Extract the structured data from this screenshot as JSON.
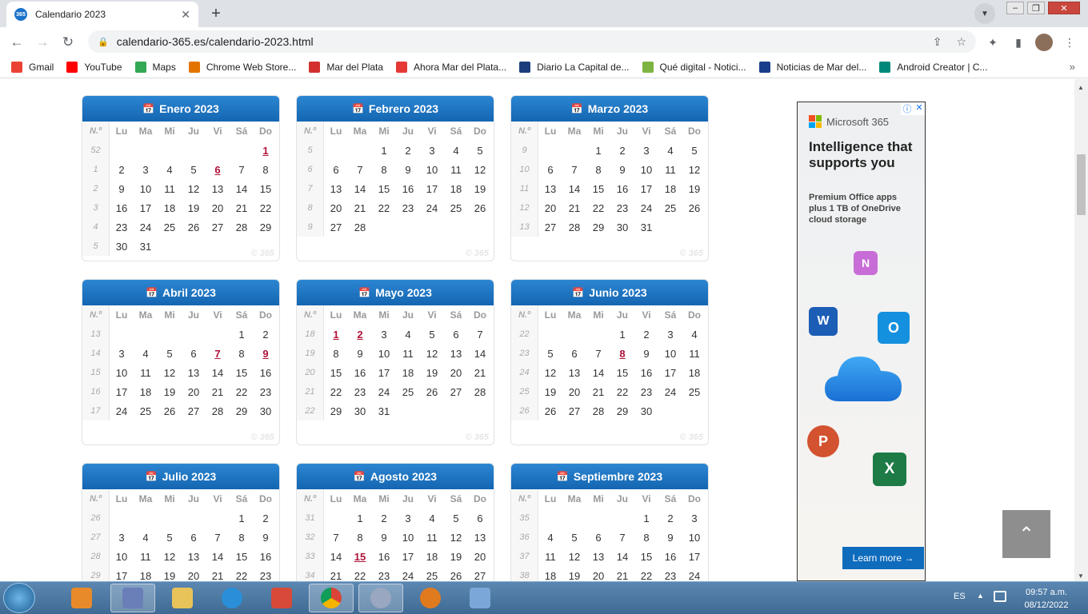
{
  "browser": {
    "tab_title": "Calendario 2023",
    "favicon_text": "365",
    "url": "calendario-365.es/calendario-2023.html",
    "bookmarks": [
      {
        "label": "Gmail",
        "icon": "gmail-icon",
        "color": "#ea4335"
      },
      {
        "label": "YouTube",
        "icon": "youtube-icon",
        "color": "#ff0000"
      },
      {
        "label": "Maps",
        "icon": "maps-icon",
        "color": "#34a853"
      },
      {
        "label": "Chrome Web Store...",
        "icon": "webstore-icon",
        "color": "#e37400"
      },
      {
        "label": "Mar del Plata",
        "icon": "mardelplata-icon",
        "color": "#d32f2f"
      },
      {
        "label": "Ahora Mar del Plata...",
        "icon": "ahora-icon",
        "color": "#e53935"
      },
      {
        "label": "Diario La Capital de...",
        "icon": "lacapital-icon",
        "color": "#1a3d7c"
      },
      {
        "label": "Qué digital - Notici...",
        "icon": "quedigital-icon",
        "color": "#7cb342"
      },
      {
        "label": "Noticias de Mar del...",
        "icon": "noticias-icon",
        "color": "#1a3d8c"
      },
      {
        "label": "Android Creator | C...",
        "icon": "androidcreator-icon",
        "color": "#00897b"
      }
    ]
  },
  "calendar": {
    "headers": [
      "N.º",
      "Lu",
      "Ma",
      "Mi",
      "Ju",
      "Vi",
      "Sá",
      "Do"
    ],
    "watermark": "© 365",
    "months": [
      {
        "name": "Enero 2023",
        "weeks": [
          [
            "52",
            "",
            "",
            "",
            "",
            "",
            "",
            "1"
          ],
          [
            "1",
            "2",
            "3",
            "4",
            "5",
            "6",
            "7",
            "8"
          ],
          [
            "2",
            "9",
            "10",
            "11",
            "12",
            "13",
            "14",
            "15"
          ],
          [
            "3",
            "16",
            "17",
            "18",
            "19",
            "20",
            "21",
            "22"
          ],
          [
            "4",
            "23",
            "24",
            "25",
            "26",
            "27",
            "28",
            "29"
          ],
          [
            "5",
            "30",
            "31",
            "",
            "",
            "",
            "",
            ""
          ]
        ],
        "holidays": [
          "1",
          "6"
        ]
      },
      {
        "name": "Febrero 2023",
        "weeks": [
          [
            "5",
            "",
            "",
            "1",
            "2",
            "3",
            "4",
            "5"
          ],
          [
            "6",
            "6",
            "7",
            "8",
            "9",
            "10",
            "11",
            "12"
          ],
          [
            "7",
            "13",
            "14",
            "15",
            "16",
            "17",
            "18",
            "19"
          ],
          [
            "8",
            "20",
            "21",
            "22",
            "23",
            "24",
            "25",
            "26"
          ],
          [
            "9",
            "27",
            "28",
            "",
            "",
            "",
            "",
            ""
          ]
        ],
        "holidays": []
      },
      {
        "name": "Marzo 2023",
        "weeks": [
          [
            "9",
            "",
            "",
            "1",
            "2",
            "3",
            "4",
            "5"
          ],
          [
            "10",
            "6",
            "7",
            "8",
            "9",
            "10",
            "11",
            "12"
          ],
          [
            "11",
            "13",
            "14",
            "15",
            "16",
            "17",
            "18",
            "19"
          ],
          [
            "12",
            "20",
            "21",
            "22",
            "23",
            "24",
            "25",
            "26"
          ],
          [
            "13",
            "27",
            "28",
            "29",
            "30",
            "31",
            "",
            ""
          ]
        ],
        "holidays": []
      },
      {
        "name": "Abril 2023",
        "weeks": [
          [
            "13",
            "",
            "",
            "",
            "",
            "",
            "1",
            "2"
          ],
          [
            "14",
            "3",
            "4",
            "5",
            "6",
            "7",
            "8",
            "9"
          ],
          [
            "15",
            "10",
            "11",
            "12",
            "13",
            "14",
            "15",
            "16"
          ],
          [
            "16",
            "17",
            "18",
            "19",
            "20",
            "21",
            "22",
            "23"
          ],
          [
            "17",
            "24",
            "25",
            "26",
            "27",
            "28",
            "29",
            "30"
          ]
        ],
        "holidays": [
          "7",
          "9"
        ]
      },
      {
        "name": "Mayo 2023",
        "weeks": [
          [
            "18",
            "1",
            "2",
            "3",
            "4",
            "5",
            "6",
            "7"
          ],
          [
            "19",
            "8",
            "9",
            "10",
            "11",
            "12",
            "13",
            "14"
          ],
          [
            "20",
            "15",
            "16",
            "17",
            "18",
            "19",
            "20",
            "21"
          ],
          [
            "21",
            "22",
            "23",
            "24",
            "25",
            "26",
            "27",
            "28"
          ],
          [
            "22",
            "29",
            "30",
            "31",
            "",
            "",
            "",
            ""
          ]
        ],
        "holidays": [
          "1",
          "2"
        ]
      },
      {
        "name": "Junio 2023",
        "weeks": [
          [
            "22",
            "",
            "",
            "",
            "1",
            "2",
            "3",
            "4"
          ],
          [
            "23",
            "5",
            "6",
            "7",
            "8",
            "9",
            "10",
            "11"
          ],
          [
            "24",
            "12",
            "13",
            "14",
            "15",
            "16",
            "17",
            "18"
          ],
          [
            "25",
            "19",
            "20",
            "21",
            "22",
            "23",
            "24",
            "25"
          ],
          [
            "26",
            "26",
            "27",
            "28",
            "29",
            "30",
            "",
            ""
          ]
        ],
        "holidays": [
          "8"
        ]
      },
      {
        "name": "Julio 2023",
        "weeks": [
          [
            "26",
            "",
            "",
            "",
            "",
            "",
            "1",
            "2"
          ],
          [
            "27",
            "3",
            "4",
            "5",
            "6",
            "7",
            "8",
            "9"
          ],
          [
            "28",
            "10",
            "11",
            "12",
            "13",
            "14",
            "15",
            "16"
          ],
          [
            "29",
            "17",
            "18",
            "19",
            "20",
            "21",
            "22",
            "23"
          ]
        ],
        "holidays": []
      },
      {
        "name": "Agosto 2023",
        "weeks": [
          [
            "31",
            "",
            "1",
            "2",
            "3",
            "4",
            "5",
            "6"
          ],
          [
            "32",
            "7",
            "8",
            "9",
            "10",
            "11",
            "12",
            "13"
          ],
          [
            "33",
            "14",
            "15",
            "16",
            "17",
            "18",
            "19",
            "20"
          ],
          [
            "34",
            "21",
            "22",
            "23",
            "24",
            "25",
            "26",
            "27"
          ]
        ],
        "holidays": [
          "15"
        ]
      },
      {
        "name": "Septiembre 2023",
        "weeks": [
          [
            "35",
            "",
            "",
            "",
            "",
            "1",
            "2",
            "3"
          ],
          [
            "36",
            "4",
            "5",
            "6",
            "7",
            "8",
            "9",
            "10"
          ],
          [
            "37",
            "11",
            "12",
            "13",
            "14",
            "15",
            "16",
            "17"
          ],
          [
            "38",
            "18",
            "19",
            "20",
            "21",
            "22",
            "23",
            "24"
          ]
        ],
        "holidays": []
      }
    ]
  },
  "ad": {
    "brand": "Microsoft 365",
    "headline": "Intelligence that supports you",
    "body": "Premium Office apps plus 1 TB of OneDrive cloud storage",
    "cta": "Learn more →",
    "choices_icon": "ⓘ",
    "close_icon": "✕",
    "apps": [
      {
        "name": "onenote-icon",
        "letter": "N",
        "color": "#c86dd7"
      },
      {
        "name": "word-icon",
        "letter": "W",
        "color": "#1c5db6"
      },
      {
        "name": "outlook-icon",
        "letter": "O",
        "color": "#1490df"
      },
      {
        "name": "powerpoint-icon",
        "letter": "P",
        "color": "#d35230"
      },
      {
        "name": "excel-icon",
        "letter": "X",
        "color": "#1e7b45"
      }
    ]
  },
  "back_to_top": "⌃",
  "taskbar": {
    "lang": "ES",
    "time": "09:57 a.m.",
    "date": "08/12/2022"
  }
}
